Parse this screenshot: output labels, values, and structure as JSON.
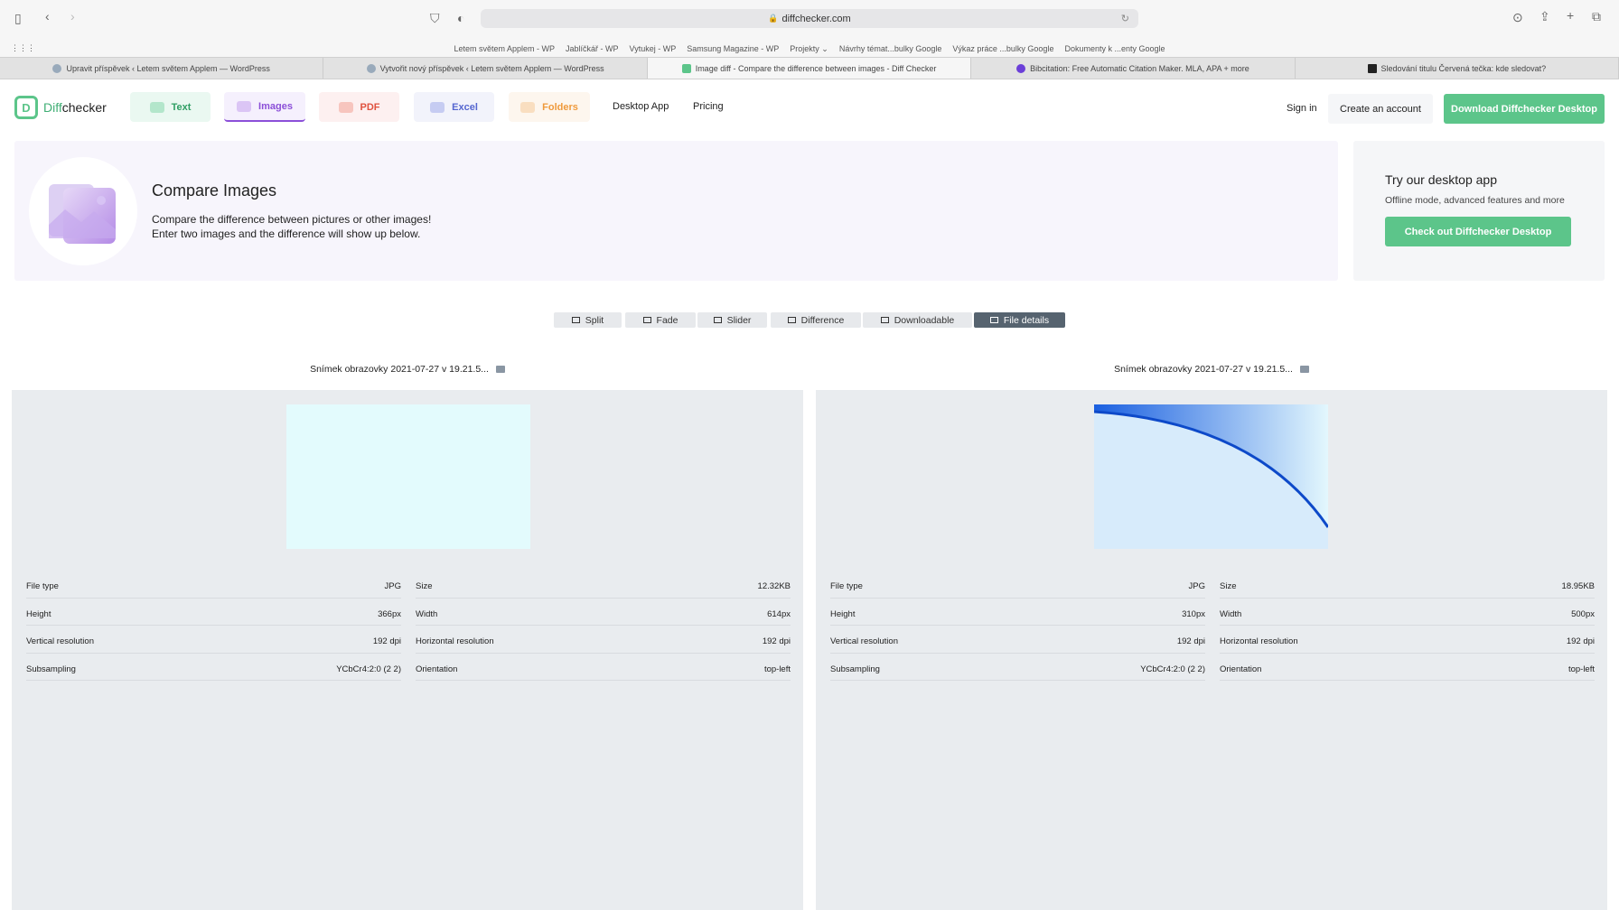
{
  "browser": {
    "url": "diffchecker.com",
    "bookmarks": [
      "Letem světem Applem - WP",
      "Jablíčkář - WP",
      "Vytukej - WP",
      "Samsung Magazine - WP",
      "Projekty ⌄",
      "Návrhy témat...bulky Google",
      "Výkaz práce ...bulky Google",
      "Dokumenty k ...enty Google"
    ],
    "tabs": [
      {
        "label": "Upravit příspěvek ‹ Letem světem Applem — WordPress"
      },
      {
        "label": "Vytvořit nový příspěvek ‹ Letem světem Applem — WordPress"
      },
      {
        "label": "Image diff - Compare the difference between images - Diff Checker"
      },
      {
        "label": "Bibcitation: Free Automatic Citation Maker. MLA, APA + more"
      },
      {
        "label": "Sledování titulu Červená tečka: kde sledovat?"
      }
    ]
  },
  "nav": {
    "logo_a": "Diff",
    "logo_b": "checker",
    "text": "Text",
    "images": "Images",
    "pdf": "PDF",
    "excel": "Excel",
    "folders": "Folders",
    "desktop": "Desktop App",
    "pricing": "Pricing",
    "signin": "Sign in",
    "create": "Create an account",
    "download": "Download Diffchecker Desktop"
  },
  "hero": {
    "title": "Compare Images",
    "line1": "Compare the difference between pictures or other images!",
    "line2": "Enter two images and the difference will show up below."
  },
  "card": {
    "title": "Try our desktop app",
    "subtitle": "Offline mode, advanced features and more",
    "button": "Check out Diffchecker Desktop"
  },
  "view_tabs": [
    "Split",
    "Fade",
    "Slider",
    "Difference",
    "Downloadable",
    "File details"
  ],
  "active_view": "File details",
  "files": [
    {
      "name": "Snímek obrazovky 2021-07-27 v 19.21.5...",
      "details": [
        [
          "File type",
          "JPG"
        ],
        [
          "Size",
          "12.32KB"
        ],
        [
          "Height",
          "366px"
        ],
        [
          "Width",
          "614px"
        ],
        [
          "Vertical resolution",
          "192 dpi"
        ],
        [
          "Horizontal resolution",
          "192 dpi"
        ],
        [
          "Subsampling",
          "YCbCr4:2:0 (2 2)"
        ],
        [
          "Orientation",
          "top-left"
        ]
      ]
    },
    {
      "name": "Snímek obrazovky 2021-07-27 v 19.21.5...",
      "details": [
        [
          "File type",
          "JPG"
        ],
        [
          "Size",
          "18.95KB"
        ],
        [
          "Height",
          "310px"
        ],
        [
          "Width",
          "500px"
        ],
        [
          "Vertical resolution",
          "192 dpi"
        ],
        [
          "Horizontal resolution",
          "192 dpi"
        ],
        [
          "Subsampling",
          "YCbCr4:2:0 (2 2)"
        ],
        [
          "Orientation",
          "top-left"
        ]
      ]
    }
  ],
  "colors": {
    "accent": "#5cc58a",
    "images": "#8b4fd8",
    "active_tab": "#56636f"
  }
}
